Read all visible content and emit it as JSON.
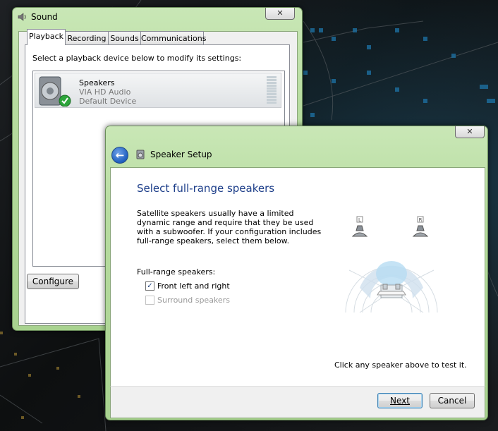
{
  "sound_window": {
    "title": "Sound",
    "close_label": "✕",
    "tabs": [
      {
        "label": "Playback"
      },
      {
        "label": "Recording"
      },
      {
        "label": "Sounds"
      },
      {
        "label": "Communications"
      }
    ],
    "instruction": "Select a playback device below to modify its settings:",
    "device": {
      "name": "Speakers",
      "driver": "VIA HD Audio",
      "status": "Default Device"
    },
    "configure_label": "Configure"
  },
  "setup_window": {
    "title": "Speaker Setup",
    "close_label": "✕",
    "back_label": "←",
    "heading": "Select full-range speakers",
    "description": "Satellite speakers usually have a limited dynamic range and require that they be used with a subwoofer.  If your configuration includes full-range speakers, select them below.",
    "fullrange_label": "Full-range speakers:",
    "options": [
      {
        "label": "Front left and right",
        "checked": true,
        "enabled": true
      },
      {
        "label": "Surround speakers",
        "checked": false,
        "enabled": false
      }
    ],
    "speaker_labels": {
      "left": "L",
      "right": "R"
    },
    "test_hint": "Click any speaker above to test it.",
    "next_label": "Next",
    "cancel_label": "Cancel"
  },
  "colors": {
    "heading_blue": "#1e3f8a",
    "title_bar_green": "#b7dca0",
    "disabled_text": "#9a9a9a"
  }
}
